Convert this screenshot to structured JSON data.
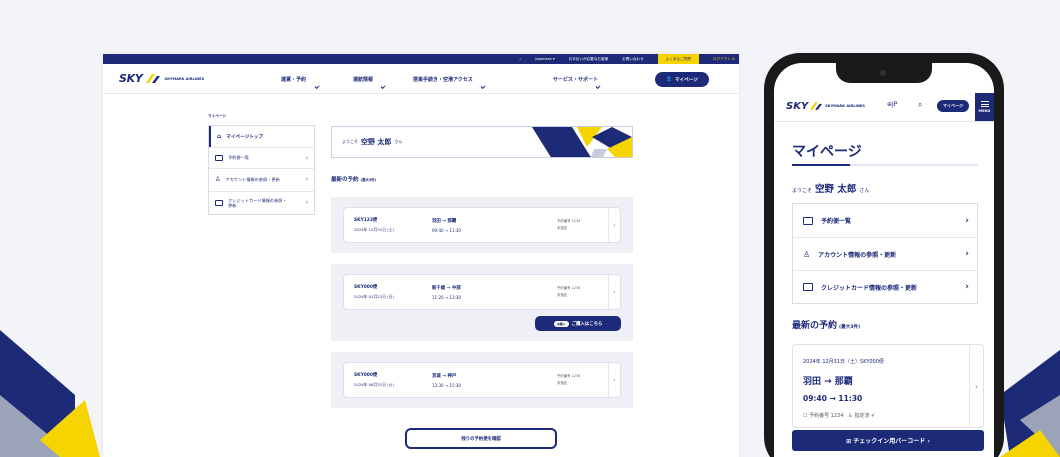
{
  "desktop": {
    "utility_bar": {
      "language": "Japanese ▾",
      "items": [
        "お手伝いが必要なお客様",
        "お問い合わせ",
        "よくあるご質問"
      ],
      "logout": "ログアウト ⊡"
    },
    "logo": {
      "text": "SKY",
      "sub": "SKYMARK AIRLINES"
    },
    "nav": [
      "運賃・予約",
      "運航情報",
      "搭乗手続き・空港アクセス",
      "サービス・サポート"
    ],
    "mypage_button": "マイページ",
    "breadcrumb": "マイページ",
    "side_menu": [
      {
        "label": "マイページトップ",
        "icon": "home-icon"
      },
      {
        "label": "予約便一覧",
        "icon": "ticket-icon"
      },
      {
        "label": "アカウント情報の参照・更新",
        "icon": "user-icon"
      },
      {
        "label": "クレジットカード情報の参照・更新",
        "icon": "credit-card-icon"
      }
    ],
    "welcome": {
      "prefix": "ようこそ",
      "name": "空野 太郎",
      "suffix": "さん"
    },
    "reservations_title": "最新の予約",
    "reservations_note": "(最大3件)",
    "reservations": [
      {
        "flight": "SKY123便",
        "date": "2024年 12月31日 (土)",
        "route": "羽田 → 那覇",
        "time": "09:40 → 11:30",
        "number": "予約番号 1234",
        "seat": "未指定"
      },
      {
        "flight": "SKY000便",
        "date": "2024年 01月22日 (日)",
        "route": "新千歳 → 中部",
        "time": "11:20 → 13:30",
        "number": "予約番号 1234",
        "seat": "未指定"
      },
      {
        "flight": "SKY000便",
        "date": "2024年 06月31日 (火)",
        "route": "茨城 → 神戸",
        "time": "13:30 → 15:30",
        "number": "予約番号 1234",
        "seat": "未指定"
      }
    ],
    "buy_pill": "未購入",
    "buy_button": "ご購入はこちら",
    "past_button": "残りの予約便を確認"
  },
  "mobile": {
    "logo": {
      "text": "SKY",
      "sub": "SKYMARK AIRLINES"
    },
    "lang": "⊕JP",
    "mypage_button": "マイページ",
    "menu_label": "MENU",
    "title": "マイページ",
    "welcome": {
      "prefix": "ようこそ",
      "name": "空野 太郎",
      "suffix": "さん"
    },
    "menu": [
      {
        "label": "予約便一覧",
        "icon": "ticket-icon"
      },
      {
        "label": "アカウント情報の参照・更新",
        "icon": "user-icon"
      },
      {
        "label": "クレジットカード情報の参照・更新",
        "icon": "credit-card-icon"
      }
    ],
    "section_title": "最新の予約",
    "section_note": "(最大3件)",
    "card": {
      "date": "2024年 12月31日（土）SKY000便",
      "route": "羽田 → 那覇",
      "time": "09:40 → 11:30",
      "meta": "☐ 予約番号 1234　♿ 指定済 ✔"
    },
    "checkin_button": "⊞ チェックイン用バーコード ›"
  },
  "colors": {
    "brand_navy": "#1c2a78",
    "brand_yellow": "#f5d400",
    "background": "#f3f4f7"
  }
}
